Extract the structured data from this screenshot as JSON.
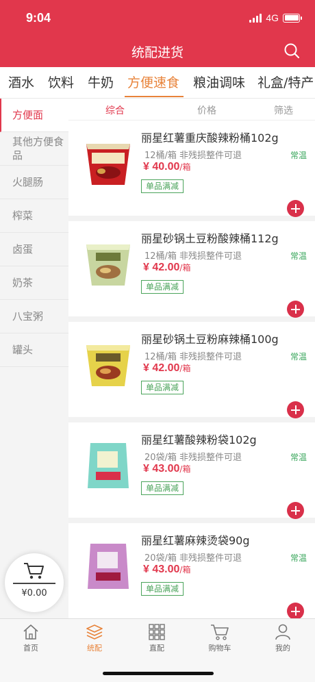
{
  "status": {
    "time": "9:04",
    "network": "4G"
  },
  "header": {
    "title": "统配进货"
  },
  "categories": [
    "酒水",
    "饮料",
    "牛奶",
    "方便速食",
    "粮油调味",
    "礼盒/特产"
  ],
  "active_category": "方便速食",
  "sidebar": [
    "方便面",
    "其他方便食品",
    "火腿肠",
    "榨菜",
    "卤蛋",
    "奶茶",
    "八宝粥",
    "罐头"
  ],
  "active_sidebar": "方便面",
  "sort": {
    "general": "综合",
    "price": "价格",
    "filter": "筛选"
  },
  "products": [
    {
      "name": "丽星红薯重庆酸辣粉桶102g",
      "spec": "12桶/箱  非残损整件可退",
      "currency": "¥",
      "price": "40.00",
      "unit": "/箱",
      "tag": "单品满减",
      "storage": "常温",
      "image_label": "重庆酸辣粉"
    },
    {
      "name": "丽星砂锅土豆粉酸辣桶112g",
      "spec": "12桶/箱  非残损整件可退",
      "currency": "¥",
      "price": "42.00",
      "unit": "/箱",
      "tag": "单品满减",
      "storage": "常温",
      "image_label": "砂锅土豆粉"
    },
    {
      "name": "丽星砂锅土豆粉麻辣桶100g",
      "spec": "12桶/箱  非残损整件可退",
      "currency": "¥",
      "price": "42.00",
      "unit": "/箱",
      "tag": "单品满减",
      "storage": "常温",
      "image_label": "砂锅土豆粉"
    },
    {
      "name": "丽星红薯酸辣粉袋102g",
      "spec": "20袋/箱  非残损整件可退",
      "currency": "¥",
      "price": "43.00",
      "unit": "/箱",
      "tag": "单品满减",
      "storage": "常温",
      "image_label": "酸辣粉"
    },
    {
      "name": "丽星红薯麻辣烫袋90g",
      "spec": "20袋/箱  非残损整件可退",
      "currency": "¥",
      "price": "43.00",
      "unit": "/箱",
      "tag": "单品满减",
      "storage": "常温",
      "image_label": "麻辣烫"
    }
  ],
  "cart": {
    "amount": "¥0.00"
  },
  "tabbar": [
    "首页",
    "统配",
    "直配",
    "购物车",
    "我的"
  ],
  "colors": {
    "brand": "#e1374c",
    "accent": "#e8833a",
    "tag_green": "#4aa35a"
  }
}
